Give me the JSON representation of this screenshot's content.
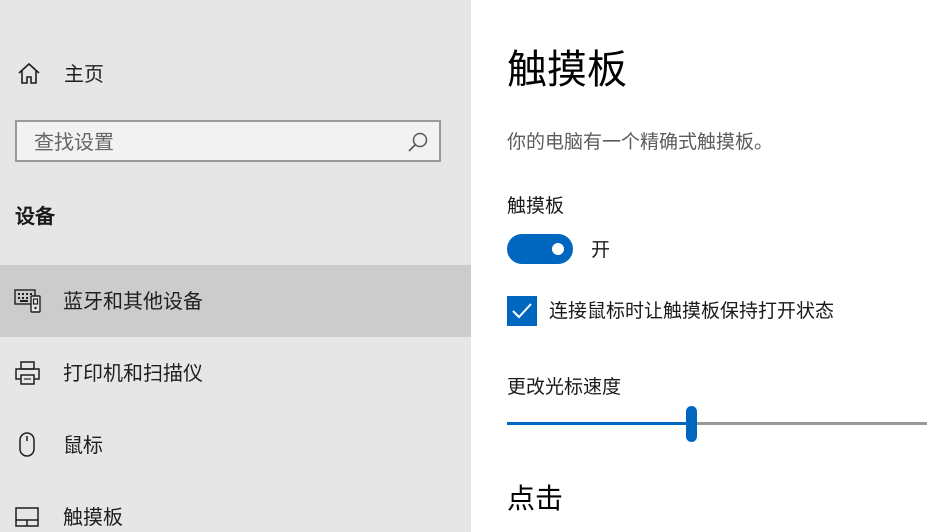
{
  "sidebar": {
    "home_label": "主页",
    "search_placeholder": "查找设置",
    "section_title": "设备",
    "items": [
      {
        "label": "蓝牙和其他设备",
        "icon": "bluetooth-devices-icon",
        "selected": true
      },
      {
        "label": "打印机和扫描仪",
        "icon": "printer-icon",
        "selected": false
      },
      {
        "label": "鼠标",
        "icon": "mouse-icon",
        "selected": false
      },
      {
        "label": "触摸板",
        "icon": "touchpad-icon",
        "selected": false
      }
    ]
  },
  "main": {
    "title": "触摸板",
    "description": "你的电脑有一个精确式触摸板。",
    "touchpad_toggle": {
      "label": "触摸板",
      "state_label": "开",
      "on": true
    },
    "keep_on_with_mouse": {
      "label": "连接鼠标时让触摸板保持打开状态",
      "checked": true
    },
    "cursor_speed": {
      "label": "更改光标速度",
      "value_fraction": 0.44
    },
    "taps_heading": "点击"
  },
  "colors": {
    "accent": "#0067c0",
    "sidebar_bg": "#e6e6e6",
    "selected_bg": "#cccccc"
  }
}
